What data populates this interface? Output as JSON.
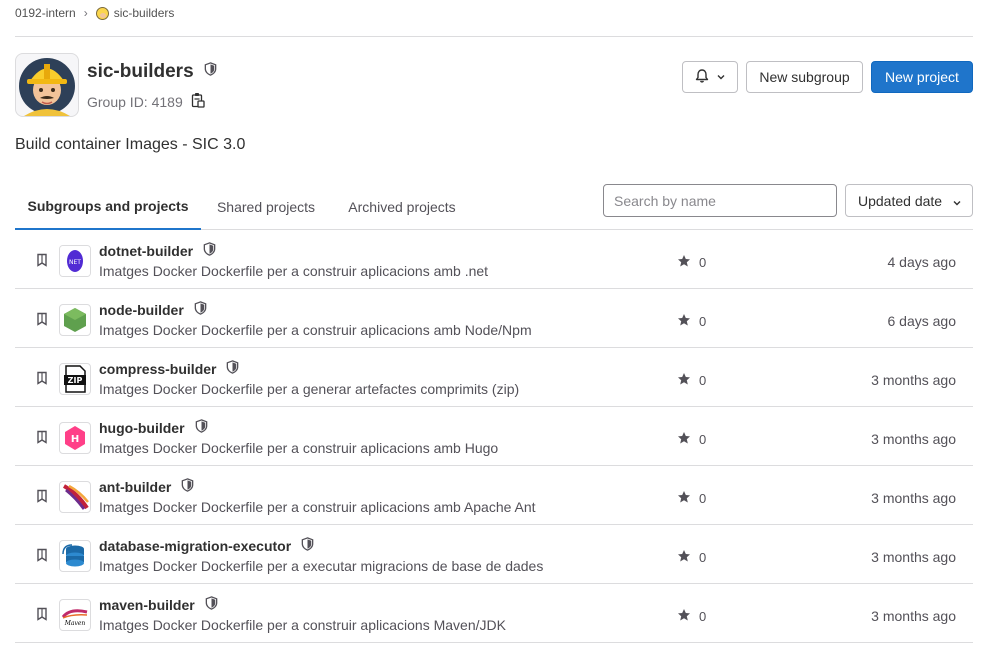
{
  "breadcrumb": {
    "parent": "0192-intern",
    "current": "sic-builders"
  },
  "group": {
    "name": "sic-builders",
    "id_label": "Group ID: 4189",
    "description": "Build container Images - SIC 3.0"
  },
  "actions": {
    "new_subgroup": "New subgroup",
    "new_project": "New project"
  },
  "tabs": [
    {
      "label": "Subgroups and projects",
      "active": true
    },
    {
      "label": "Shared projects",
      "active": false
    },
    {
      "label": "Archived projects",
      "active": false
    }
  ],
  "search": {
    "placeholder": "Search by name",
    "value": ""
  },
  "sort": {
    "label": "Updated date"
  },
  "colors": {
    "primary": "#1f75cb",
    "border": "#dcdcde",
    "text": "#303030",
    "muted": "#535158"
  },
  "projects": [
    {
      "name": "dotnet-builder",
      "description": "Imatges Docker Dockerfile per a construir aplicacions amb .net",
      "stars": "0",
      "updated": "4 days ago",
      "icon": "dotnet-logo-icon"
    },
    {
      "name": "node-builder",
      "description": "Imatges Docker Dockerfile per a construir aplicacions amb Node/Npm",
      "stars": "0",
      "updated": "6 days ago",
      "icon": "nodejs-logo-icon"
    },
    {
      "name": "compress-builder",
      "description": "Imatges Docker Dockerfile per a generar artefactes comprimits (zip)",
      "stars": "0",
      "updated": "3 months ago",
      "icon": "zip-file-icon"
    },
    {
      "name": "hugo-builder",
      "description": "Imatges Docker Dockerfile per a construir aplicacions amb Hugo",
      "stars": "0",
      "updated": "3 months ago",
      "icon": "hugo-logo-icon"
    },
    {
      "name": "ant-builder",
      "description": "Imatges Docker Dockerfile per a construir aplicacions amb Apache Ant",
      "stars": "0",
      "updated": "3 months ago",
      "icon": "apache-ant-logo-icon"
    },
    {
      "name": "database-migration-executor",
      "description": "Imatges Docker Dockerfile per a executar migracions de base de dades",
      "stars": "0",
      "updated": "3 months ago",
      "icon": "database-logo-icon"
    },
    {
      "name": "maven-builder",
      "description": "Imatges Docker Dockerfile per a construir aplicacions Maven/JDK",
      "stars": "0",
      "updated": "3 months ago",
      "icon": "maven-logo-icon",
      "icon_text": "Maven"
    }
  ]
}
